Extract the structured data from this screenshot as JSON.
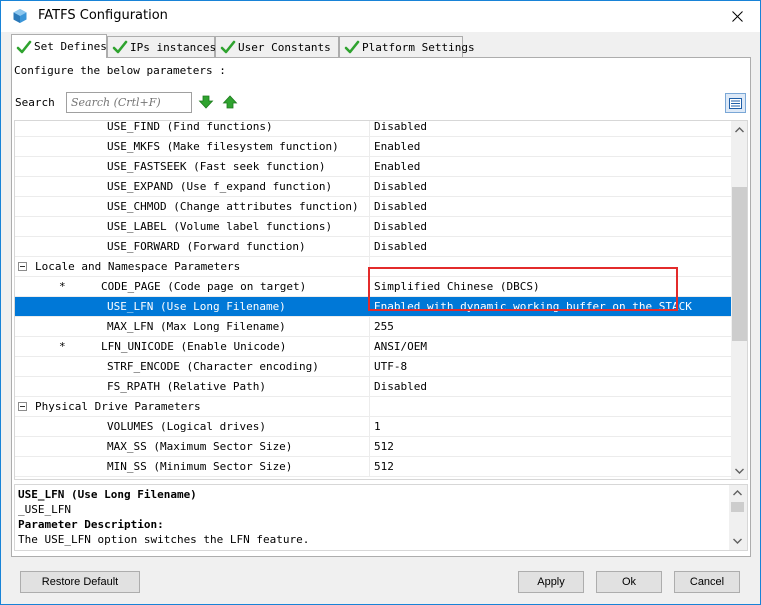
{
  "window": {
    "title": "FATFS Configuration"
  },
  "tabs": [
    {
      "label": "Set Defines",
      "active": true
    },
    {
      "label": "IPs instances",
      "active": false
    },
    {
      "label": "User Constants",
      "active": false
    },
    {
      "label": "Platform Settings",
      "active": false
    }
  ],
  "panel": {
    "configure_label": "Configure the below parameters :",
    "search_label": "Search",
    "search_placeholder": "Search (Crtl+F)"
  },
  "params": [
    {
      "kind": "param",
      "name": "USE_FIND (Find functions)",
      "value": "Disabled",
      "starred": false
    },
    {
      "kind": "param",
      "name": "USE_MKFS (Make filesystem function)",
      "value": "Enabled",
      "starred": false
    },
    {
      "kind": "param",
      "name": "USE_FASTSEEK (Fast seek function)",
      "value": "Enabled",
      "starred": false
    },
    {
      "kind": "param",
      "name": "USE_EXPAND (Use f_expand function)",
      "value": "Disabled",
      "starred": false
    },
    {
      "kind": "param",
      "name": "USE_CHMOD (Change attributes function)",
      "value": "Disabled",
      "starred": false
    },
    {
      "kind": "param",
      "name": "USE_LABEL (Volume label functions)",
      "value": "Disabled",
      "starred": false
    },
    {
      "kind": "param",
      "name": "USE_FORWARD (Forward function)",
      "value": "Disabled",
      "starred": false
    },
    {
      "kind": "group",
      "name": "Locale and Namespace Parameters",
      "value": "",
      "starred": false
    },
    {
      "kind": "param",
      "name": "CODE_PAGE (Code page on target)",
      "value": "Simplified Chinese (DBCS)",
      "starred": true
    },
    {
      "kind": "param",
      "name": "USE_LFN (Use Long Filename)",
      "value": "Enabled with dynamic working buffer on the STACK",
      "starred": false,
      "selected": true
    },
    {
      "kind": "param",
      "name": "MAX_LFN (Max Long Filename)",
      "value": "255",
      "starred": false
    },
    {
      "kind": "param",
      "name": "LFN_UNICODE (Enable Unicode)",
      "value": "ANSI/OEM",
      "starred": true
    },
    {
      "kind": "param",
      "name": "STRF_ENCODE (Character encoding)",
      "value": "UTF-8",
      "starred": false
    },
    {
      "kind": "param",
      "name": "FS_RPATH (Relative Path)",
      "value": "Disabled",
      "starred": false
    },
    {
      "kind": "group",
      "name": "Physical Drive Parameters",
      "value": "",
      "starred": false
    },
    {
      "kind": "param",
      "name": "VOLUMES (Logical drives)",
      "value": "1",
      "starred": false
    },
    {
      "kind": "param",
      "name": "MAX_SS (Maximum Sector Size)",
      "value": "512",
      "starred": false
    },
    {
      "kind": "param",
      "name": "MIN_SS (Minimum Sector Size)",
      "value": "512",
      "starred": false
    }
  ],
  "star_symbol": "*",
  "description": {
    "title": "USE_LFN (Use Long Filename)",
    "define": "_USE_LFN",
    "heading": "Parameter Description:",
    "text": "The USE_LFN option switches the LFN feature."
  },
  "buttons": {
    "restore": "Restore Default",
    "apply": "Apply",
    "ok": "Ok",
    "cancel": "Cancel"
  },
  "colors": {
    "selection": "#0078d7",
    "highlight": "#e32b2b",
    "arrow_green": "#2fa32f"
  }
}
